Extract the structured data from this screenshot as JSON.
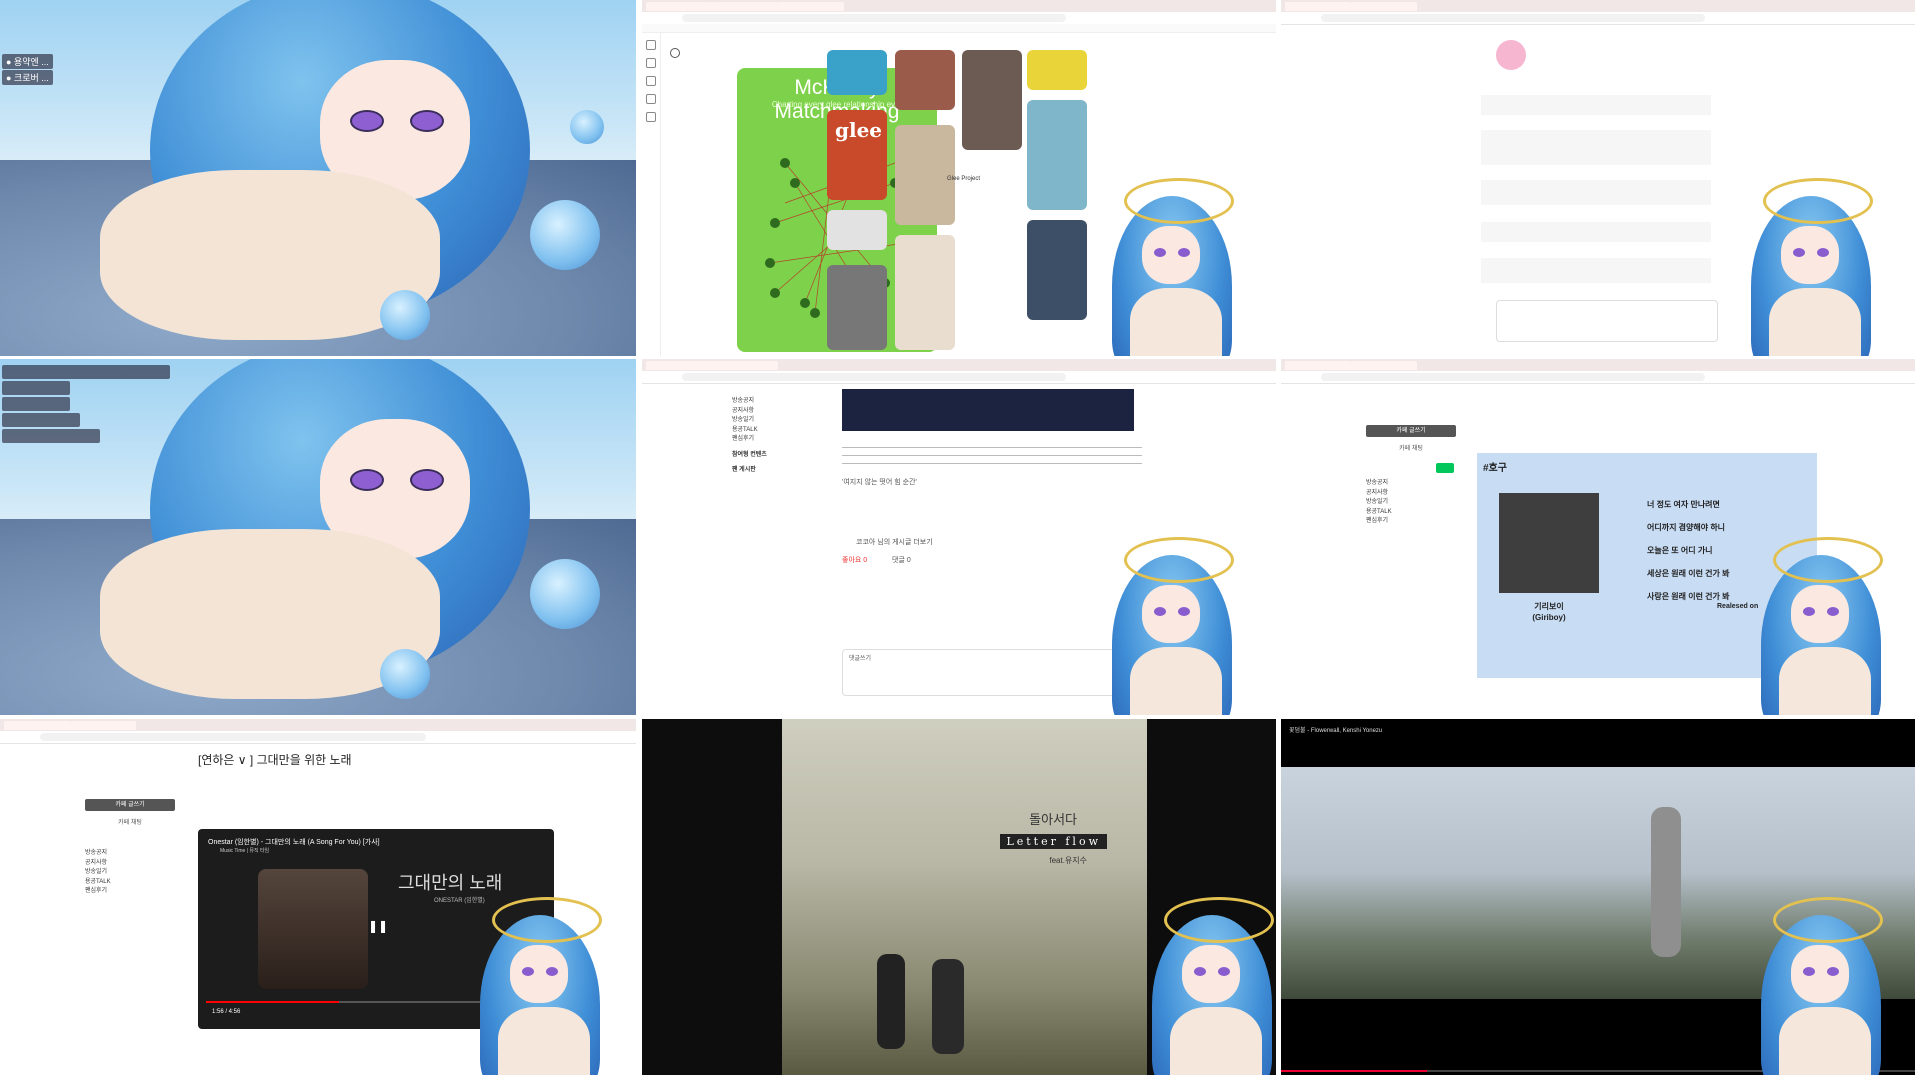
{
  "tiles": {
    "t2": {
      "pin_title": "McKinley Matchmaking",
      "pin_subtitle": "Charting every glee relationship ever",
      "glee_logo": "glee",
      "glee_caption": "Glee Project"
    },
    "t5": {
      "lyric_quote": "'여지지 않는 떳어 힘 순간'",
      "board_label": "코코아 님의 게시글 더보기",
      "like_label": "좋아요 0",
      "comment_label": "댓글 0",
      "comment_heading": "댓글쓰기"
    },
    "t6": {
      "tag": "#호구",
      "artist": "기리보이",
      "artist_en": "(Giriboy)",
      "released": "Realesed on",
      "lyric_lines": [
        "너 정도 여자 만나려면",
        "어디까지 겸양해야 하니",
        "오늘은 또 어디 가니",
        "세상은 원래 이런 건가 봐",
        "사랑은 원래 이런 건가 봐"
      ],
      "cafe_btn": "카페 글쓰기",
      "chat_btn": "카페 채팅"
    },
    "t7": {
      "post_title": "[연하은 ∨ ] 그대만을 위한 노래",
      "video_title": "Onestar (임한별) - 그대만의 노래 (A Song For You) [가사]",
      "video_channel": "Music Time | 뮤직 타임",
      "album_title": "그대만의 노래",
      "album_artist": "ONESTAR (임한별)",
      "time": "1:56 / 4:56",
      "cafe_btn": "카페 글쓰기",
      "chat_btn": "카페 채팅"
    },
    "t8": {
      "title_kr": "돌아서다",
      "title_en": "Letter flow",
      "feat": "feat.유지수"
    },
    "t9": {
      "video_title": "꽃덤불 - Flowerwall, Kenshi Yonezu"
    }
  },
  "menu": {
    "items": [
      "방송공지",
      "공지사항",
      "방송일기",
      "용공TALK",
      "팬심후기"
    ],
    "section_titles": [
      "참여형 컨텐츠",
      "팬 게시판"
    ]
  },
  "colors": {
    "accent": "#03c75a",
    "pin_bg": "#7ed14a",
    "halo": "#e7c55a"
  }
}
